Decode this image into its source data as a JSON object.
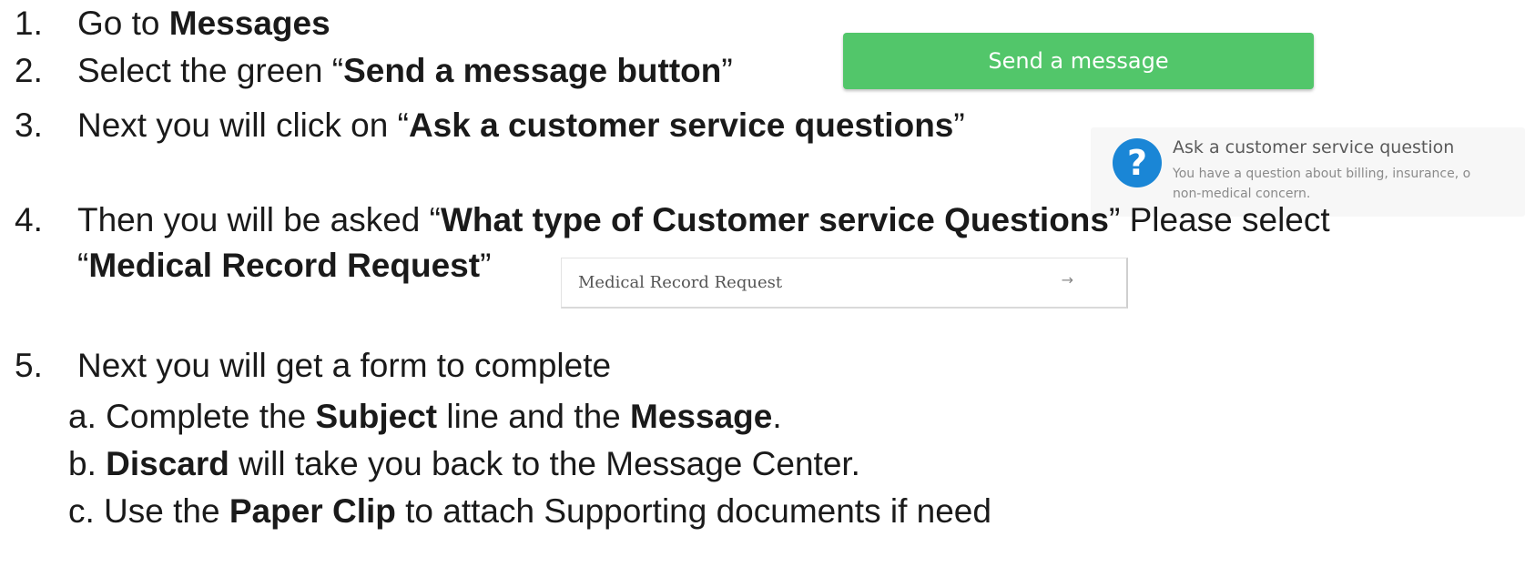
{
  "steps": {
    "s1": {
      "num": "1.",
      "pre": "Go to ",
      "bold": "Messages"
    },
    "s2": {
      "num": "2.",
      "pre": "Select the green “",
      "bold": "Send a message button",
      "post": "”"
    },
    "s3": {
      "num": "3.",
      "pre": "Next you will click on “",
      "bold": "Ask a customer service questions",
      "post": "”"
    },
    "s4": {
      "num": "4.",
      "pre": "Then you will be asked “",
      "bold": "What type of Customer service Questions",
      "post": "” Please select",
      "line2_open": "“",
      "line2_bold": "Medical Record Request",
      "line2_close": "”"
    },
    "s5": {
      "num": "5.",
      "text": "Next you will get a form to complete"
    },
    "s5a": {
      "pre": "a. Complete the ",
      "bold1": "Subject",
      "mid": " line and the ",
      "bold2": "Message",
      "post": "."
    },
    "s5b": {
      "pre": "b. ",
      "bold": "Discard",
      "post": " will take you back to the Message Center."
    },
    "s5c": {
      "pre": "c. Use the ",
      "bold": "Paper Clip",
      "post": " to attach Supporting documents if need"
    }
  },
  "send_button": {
    "label": "Send a message"
  },
  "cs_option": {
    "icon": "question-icon",
    "icon_glyph": "?",
    "title": "Ask a customer service question",
    "desc_line1": "You have a question about billing, insurance, o",
    "desc_line2": "non-medical concern."
  },
  "mr_option": {
    "label": "Medical Record Request",
    "arrow": "→",
    "arrow_icon": "arrow-right-icon"
  },
  "colors": {
    "button_green": "#52c66a",
    "icon_blue": "#1a86d6"
  }
}
